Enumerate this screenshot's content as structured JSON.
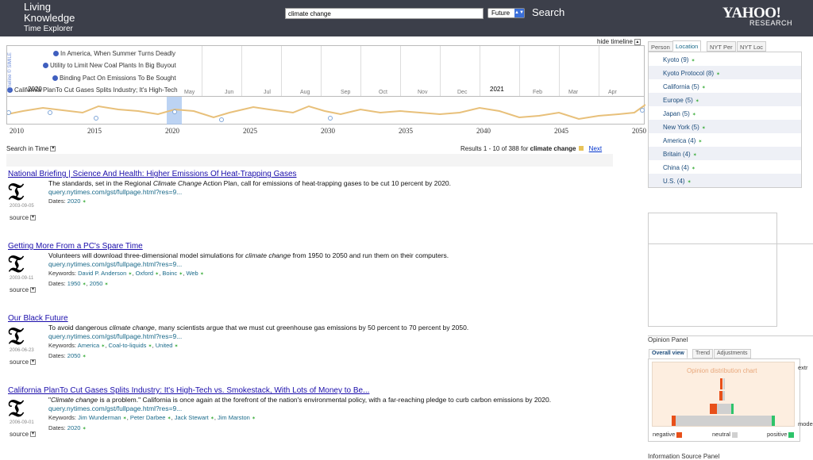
{
  "header": {
    "logo_line1": "Living",
    "logo_line2": "Knowledge",
    "logo_line3": "Time Explorer",
    "search_value": "climate change",
    "time_select": "Future",
    "search_button": "Search",
    "brand": "YAHOO!",
    "brand_sub": "RESEARCH"
  },
  "timeline": {
    "hide_label": "hide timeline",
    "simile": "Timeline © SIMILE",
    "year_left": "2020",
    "year_right": "2021",
    "months": [
      "May",
      "Jun",
      "Jul",
      "Aug",
      "Sep",
      "Oct",
      "Nov",
      "Dec",
      "Feb",
      "Mar",
      "Apr"
    ],
    "events": [
      "In America, When Summer Turns Deadly",
      "Utility to Limit New Coal Plants In Big Buyout",
      "Binding Pact On Emissions To Be Sought",
      "California PlanTo Cut Gases Splits Industry; It's High-Tech"
    ],
    "overview_years": [
      "2010",
      "2015",
      "2020",
      "2025",
      "2030",
      "2035",
      "2040",
      "2045",
      "2050"
    ]
  },
  "results_header": {
    "search_in_time": "Search in Time",
    "results_text": "Results 1 - 10 of 388 for",
    "query": "climate change",
    "next": "Next"
  },
  "results": [
    {
      "title": "National Briefing | Science And Health: Higher Emissions Of Heat-Trapping Gases",
      "date": "2003-09-05",
      "snippet_pre": "The standards, set in the Regional ",
      "snippet_em": "Climate Change",
      "snippet_post": " Action Plan, call for emissions of heat-trapping gases to be cut 10 percent by 2020.",
      "url": "query.nytimes.com/gst/fullpage.html?res=9...",
      "keywords_label": "",
      "keywords": [],
      "dates_label": "Dates:",
      "dates": [
        "2020"
      ],
      "source": "source"
    },
    {
      "title": "Getting More From a PC's Spare Time",
      "date": "2003-09-11",
      "snippet_pre": "Volunteers will download three-dimensional model simulations for ",
      "snippet_em": "climate change",
      "snippet_post": " from 1950 to 2050 and run them on their computers.",
      "url": "query.nytimes.com/gst/fullpage.html?res=9...",
      "keywords_label": "Keywords:",
      "keywords": [
        "David P. Anderson",
        "Oxford",
        "Boinc",
        "Web"
      ],
      "dates_label": "Dates:",
      "dates": [
        "1950",
        "2050"
      ],
      "source": "source"
    },
    {
      "title": "Our Black Future",
      "date": "2006-06-23",
      "snippet_pre": "To avoid dangerous ",
      "snippet_em": "climate change",
      "snippet_post": ", many scientists argue that we must cut greenhouse gas emissions by 50 percent to 70 percent by 2050.",
      "url": "query.nytimes.com/gst/fullpage.html?res=9...",
      "keywords_label": "Keywords:",
      "keywords": [
        "America",
        "Coal-to-liquids",
        "United"
      ],
      "dates_label": "Dates:",
      "dates": [
        "2050"
      ],
      "source": "source"
    },
    {
      "title": "California PlanTo Cut Gases Splits Industry: It's High-Tech vs. Smokestack, With Lots of Money to Be...",
      "date": "2006-09-01",
      "snippet_pre": "\"",
      "snippet_em": "Climate change",
      "snippet_post": " is a problem.\" California is once again at the forefront of the nation's environmental policy, with a far-reaching pledge to curb carbon emissions by 2020.",
      "url": "query.nytimes.com/gst/fullpage.html?res=9...",
      "keywords_label": "Keywords:",
      "keywords": [
        "Jim Wunderman",
        "Peter Darbee",
        "Jack Stewart",
        "Jim Marston"
      ],
      "dates_label": "Dates:",
      "dates": [
        "2020"
      ],
      "source": "source"
    }
  ],
  "right_panel": {
    "tabs": [
      "Person",
      "Location",
      "NYT Per",
      "NYT Loc"
    ],
    "locations": [
      "Kyoto (9)",
      "Kyoto Protocol (8)",
      "California (5)",
      "Europe (5)",
      "Japan (5)",
      "New York (5)",
      "America (4)",
      "Britain (4)",
      "China (4)",
      "U.S. (4)"
    ]
  },
  "opinion": {
    "title": "Opinion Panel",
    "tabs": [
      "Overall view",
      "Trend",
      "Adjustments"
    ],
    "chart_title": "Opinion distribution chart",
    "negative": "negative",
    "neutral": "neutral",
    "positive": "positive",
    "extreme": "extr",
    "moderate": "mode",
    "colors": {
      "negative": "#e8501a",
      "neutral": "#d0d0d0",
      "positive": "#2ec46a"
    }
  },
  "info_source": "Information Source Panel"
}
